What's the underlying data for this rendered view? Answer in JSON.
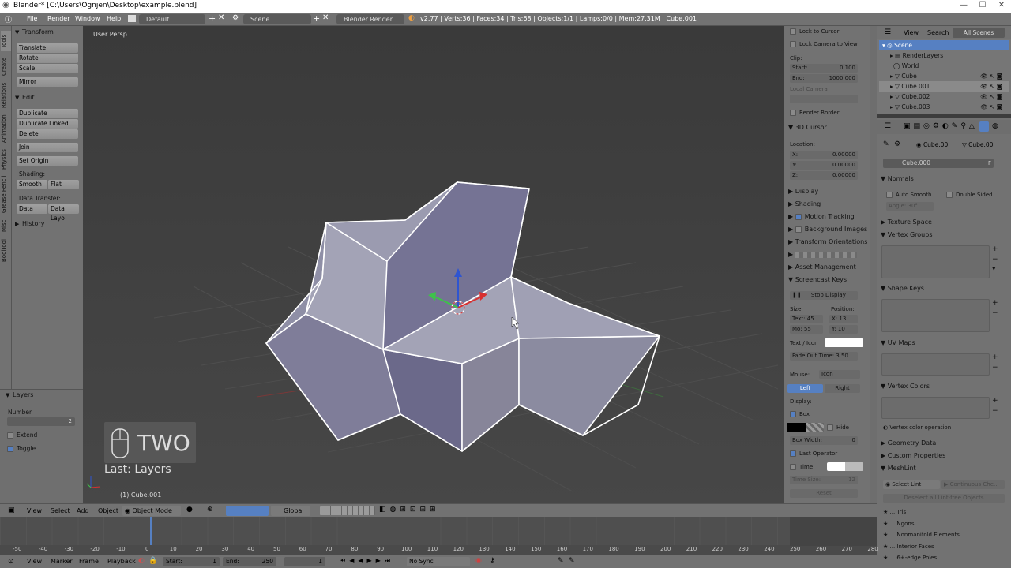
{
  "window": {
    "title": "Blender* [C:\\Users\\Ognjen\\Desktop\\example.blend]",
    "minimize": "—",
    "maximize": "☐",
    "close": "✕"
  },
  "menubar": {
    "items": [
      "File",
      "Render",
      "Window",
      "Help"
    ],
    "layout": "Default",
    "scene": "Scene",
    "engine": "Blender Render",
    "stats": "v2.77 | Verts:36 | Faces:34 | Tris:68 | Objects:1/1 | Lamps:0/0 | Mem:27.31M | Cube.001"
  },
  "left_tabs": [
    "Tools",
    "Create",
    "Relations",
    "Animation",
    "Physics",
    "Grease Pencil",
    "Misc",
    "BoolTool"
  ],
  "toolshelf": {
    "transform": {
      "header": "Transform",
      "buttons": [
        "Translate",
        "Rotate",
        "Scale",
        "Mirror"
      ]
    },
    "edit": {
      "header": "Edit",
      "buttons": [
        "Duplicate",
        "Duplicate Linked",
        "Delete",
        "Join",
        "Set Origin"
      ],
      "shading_label": "Shading:",
      "smooth": "Smooth",
      "flat": "Flat",
      "data_transfer_label": "Data Transfer:",
      "data": "Data",
      "data_layo": "Data Layo"
    },
    "history": "History",
    "layers": {
      "header": "Layers",
      "number_label": "Number",
      "number_value": "2",
      "extend": "Extend",
      "toggle": "Toggle"
    }
  },
  "viewport": {
    "view_label": "User Persp",
    "object_label": "(1) Cube.001",
    "screencast_key": "TWO",
    "last_op": "Last: Layers"
  },
  "npanel": {
    "lock_to_cursor": "Lock to Cursor",
    "lock_camera": "Lock Camera to View",
    "clip": "Clip:",
    "start_label": "Start:",
    "start_value": "0.100",
    "end_label": "End:",
    "end_value": "1000.000",
    "local_camera": "Local Camera",
    "render_border": "Render Border",
    "cursor_header": "3D Cursor",
    "location": "Location:",
    "x_label": "X:",
    "x_value": "0.00000",
    "y_label": "Y:",
    "y_value": "0.00000",
    "z_label": "Z:",
    "z_value": "0.00000",
    "sections": [
      "Display",
      "Shading",
      "Motion Tracking",
      "Background Images",
      "Transform Orientations",
      "",
      "Asset Management",
      "Screencast Keys"
    ],
    "stop_display": "Stop Display",
    "size": "Size:",
    "position": "Position:",
    "text_size": "Text: 45",
    "pos_x": "X: 13",
    "mouse_size": "Mo: 55",
    "pos_y": "Y: 10",
    "text_icon": "Text / Icon",
    "fade_out": "Fade Out Time: 3.50",
    "mouse_label": "Mouse:",
    "mouse_value": "Icon",
    "left": "Left",
    "right": "Right",
    "display_label": "Display:",
    "box": "Box",
    "hide": "Hide",
    "box_width": "Box Width:",
    "box_width_value": "0",
    "last_operator": "Last Operator",
    "time": "Time",
    "time_size": "Time Size:",
    "time_size_value": "12",
    "reset": "Reset"
  },
  "outliner": {
    "view": "View",
    "search": "Search",
    "all_scenes": "All Scenes",
    "items": [
      "Scene",
      "RenderLayers",
      "World",
      "Cube",
      "Cube.001",
      "Cube.002",
      "Cube.003"
    ]
  },
  "properties": {
    "breadcrumb_a": "Cube.00",
    "breadcrumb_b": "Cube.00",
    "mesh_name": "Cube.000",
    "f_label": "F",
    "normals": "Normals",
    "auto_smooth": "Auto Smooth",
    "double_sided": "Double Sided",
    "angle": "Angle:",
    "angle_value": "30°",
    "sections": [
      "Texture Space",
      "Vertex Groups",
      "Shape Keys",
      "UV Maps",
      "Vertex Colors"
    ],
    "vertex_color_op": "Vertex color operation",
    "geometry_data": "Geometry Data",
    "custom_props": "Custom Properties",
    "meshlint": "MeshLint",
    "select_lint": "Select Lint",
    "continuous": "Continuous Che...",
    "deselect_all": "Deselect all Lint-free Objects",
    "lint_items": [
      "... Tris",
      "... Ngons",
      "... Nonmanifold Elements",
      "... Interior Faces",
      "... 6+-edge Poles"
    ]
  },
  "view3d_header": {
    "view": "View",
    "select": "Select",
    "add": "Add",
    "object": "Object",
    "mode": "Object Mode",
    "orientation": "Global"
  },
  "timeline": {
    "ticks": [
      "-50",
      "-40",
      "-30",
      "-20",
      "-10",
      "0",
      "10",
      "20",
      "30",
      "40",
      "50",
      "60",
      "70",
      "80",
      "90",
      "100",
      "110",
      "120",
      "130",
      "140",
      "150",
      "160",
      "170",
      "180",
      "190",
      "200",
      "210",
      "220",
      "230",
      "240",
      "250",
      "260",
      "270",
      "280"
    ],
    "view": "View",
    "marker": "Marker",
    "frame": "Frame",
    "playback": "Playback",
    "start_label": "Start:",
    "start_value": "1",
    "end_label": "End:",
    "end_value": "250",
    "current": "1",
    "sync": "No Sync"
  }
}
